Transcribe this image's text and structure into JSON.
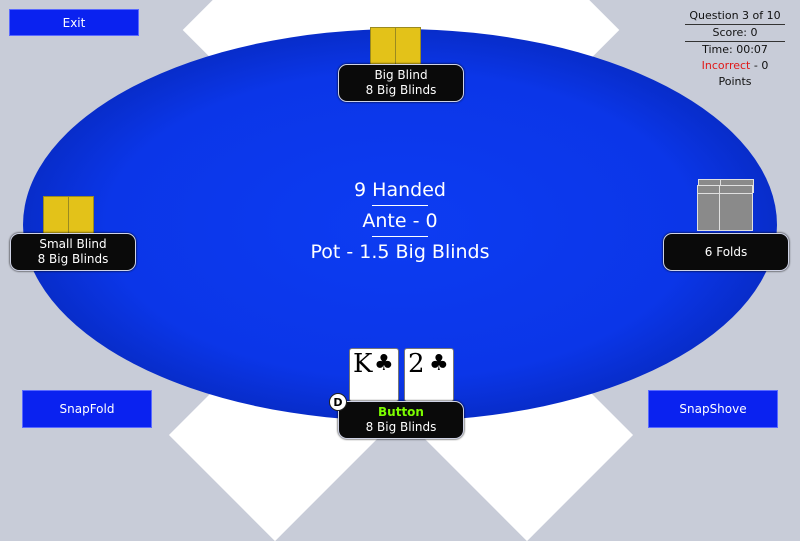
{
  "controls": {
    "exit_label": "Exit",
    "snapfold_label": "SnapFold",
    "snapshove_label": "SnapShove"
  },
  "hud": {
    "question": "Question 3 of 10",
    "score": "Score: 0",
    "time": "Time: 00:07",
    "result_word": "Incorrect",
    "result_rest": " - 0 Points"
  },
  "table_info": {
    "handed": "9 Handed",
    "ante": "Ante - 0",
    "pot": "Pot - 1.5 Big Blinds"
  },
  "seats": {
    "big_blind": {
      "position": "Big Blind",
      "stack": "8 Big Blinds"
    },
    "small_blind": {
      "position": "Small Blind",
      "stack": "8 Big Blinds"
    },
    "folds": {
      "label": "6 Folds"
    },
    "hero": {
      "position": "Button",
      "stack": "8 Big Blinds"
    }
  },
  "hero_cards": [
    {
      "rank": "K",
      "suit": "♣"
    },
    {
      "rank": "2",
      "suit": "♣"
    }
  ],
  "dealer_button": "D",
  "colors": {
    "felt": "#0b36e8",
    "button_blue": "#0a22f0",
    "card_back": "#e3c219",
    "folded_card": "#8a8a8a",
    "hero_label": "#7CFC00",
    "incorrect": "#e01818"
  }
}
